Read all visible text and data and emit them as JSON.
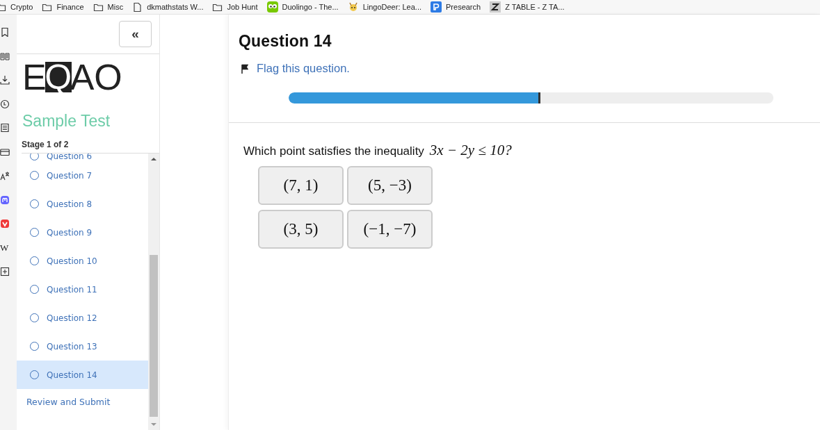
{
  "bookmarks": [
    {
      "kind": "folder",
      "label": "Crypto"
    },
    {
      "kind": "folder",
      "label": "Finance"
    },
    {
      "kind": "folder",
      "label": "Misc"
    },
    {
      "kind": "page",
      "label": "dkmathstats W..."
    },
    {
      "kind": "folder",
      "label": "Job Hunt"
    },
    {
      "kind": "owl",
      "label": "Duolingo - The..."
    },
    {
      "kind": "deer",
      "label": "LingoDeer: Lea..."
    },
    {
      "kind": "presearch",
      "label": "Presearch"
    },
    {
      "kind": "ztable",
      "label": "Z TABLE - Z TA..."
    }
  ],
  "side_panel": {
    "icons": [
      {
        "kind": "bookmark"
      },
      {
        "kind": "reader"
      },
      {
        "kind": "download"
      },
      {
        "kind": "clock"
      },
      {
        "kind": "notes"
      },
      {
        "kind": "card"
      },
      {
        "kind": "translate"
      },
      {
        "kind": "mastodon"
      },
      {
        "kind": "vivaldi"
      },
      {
        "kind": "wiki",
        "label": "W"
      },
      {
        "kind": "add"
      }
    ]
  },
  "navigation": {
    "collapse_button": "«",
    "logo": {
      "left": "E",
      "boxed": "Q",
      "right": "AO"
    },
    "title": "Sample Test",
    "stage": "Stage 1 of 2",
    "questions": [
      {
        "label": "Question 6",
        "selected": false
      },
      {
        "label": "Question 7",
        "selected": false
      },
      {
        "label": "Question 8",
        "selected": false
      },
      {
        "label": "Question 9",
        "selected": false
      },
      {
        "label": "Question 10",
        "selected": false
      },
      {
        "label": "Question 11",
        "selected": false
      },
      {
        "label": "Question 12",
        "selected": false
      },
      {
        "label": "Question 13",
        "selected": false
      },
      {
        "label": "Question 14",
        "selected": true
      }
    ],
    "review_link": "Review and Submit"
  },
  "question": {
    "title": "Question 14",
    "flag_link": "Flag this question.",
    "progress": {
      "level": 0.52
    },
    "prompt": "Which point satisfies the inequality",
    "expression": "3x − 2y ≤ 10?",
    "options": [
      "(7, 1)",
      "(5, −3)",
      "(3, 5)",
      "(−1, −7)"
    ]
  }
}
